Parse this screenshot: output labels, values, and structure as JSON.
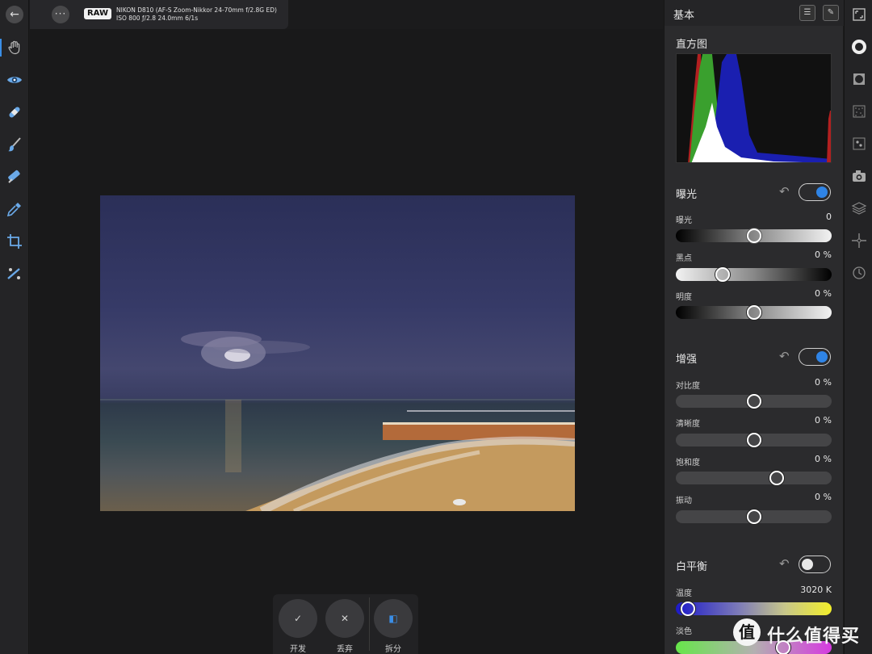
{
  "topbar": {
    "raw_badge": "RAW",
    "camera_line": "NIKON D810 (AF-S Zoom-Nikkor 24-70mm f/2.8G ED)",
    "exposure_line": "ISO 800 ƒ/2.8 24.0mm 6/1s",
    "back_glyph": "←",
    "more_glyph": "···"
  },
  "left_tools": [
    "hand-tool-icon",
    "eye-icon",
    "bandage-icon",
    "brush-icon",
    "gradient-brush-icon",
    "color-picker-icon",
    "crop-icon",
    "straighten-icon"
  ],
  "actions": {
    "develop": {
      "glyph": "✓",
      "label": "开发"
    },
    "discard": {
      "glyph": "✕",
      "label": "丢弃"
    },
    "split": {
      "glyph": "◧",
      "label": "拆分"
    }
  },
  "panel": {
    "title": "基本",
    "histogram_title": "直方图",
    "exposure_section": {
      "title": "曝光",
      "enabled": true,
      "sliders": [
        {
          "label": "曝光",
          "value": "0",
          "position": 0.5
        },
        {
          "label": "黑点",
          "value": "0 %",
          "position": 0.3
        },
        {
          "label": "明度",
          "value": "0 %",
          "position": 0.5
        }
      ]
    },
    "enhance_section": {
      "title": "增强",
      "enabled": true,
      "sliders": [
        {
          "label": "对比度",
          "value": "0 %",
          "position": 0.5
        },
        {
          "label": "清晰度",
          "value": "0 %",
          "position": 0.5
        },
        {
          "label": "饱和度",
          "value": "0 %",
          "position": 0.65
        },
        {
          "label": "振动",
          "value": "0 %",
          "position": 0.5
        }
      ]
    },
    "white_balance_section": {
      "title": "白平衡",
      "enabled": false,
      "sliders": [
        {
          "label": "温度",
          "value": "3020 K",
          "position": 0.08
        },
        {
          "label": "淡色",
          "value": "",
          "position": 0.69
        }
      ]
    }
  },
  "right_rail": [
    "maximize-icon",
    "tone-wheel-icon",
    "vignette-icon",
    "noise-icon",
    "dots-icon",
    "camera-icon",
    "layers-icon",
    "sparkle-icon",
    "history-icon"
  ],
  "watermark": {
    "logo": "值",
    "text": "什么值得买"
  },
  "colors": {
    "accent": "#2f84e6",
    "panel_bg": "#2b2b2d",
    "canvas_bg": "#19191a"
  }
}
